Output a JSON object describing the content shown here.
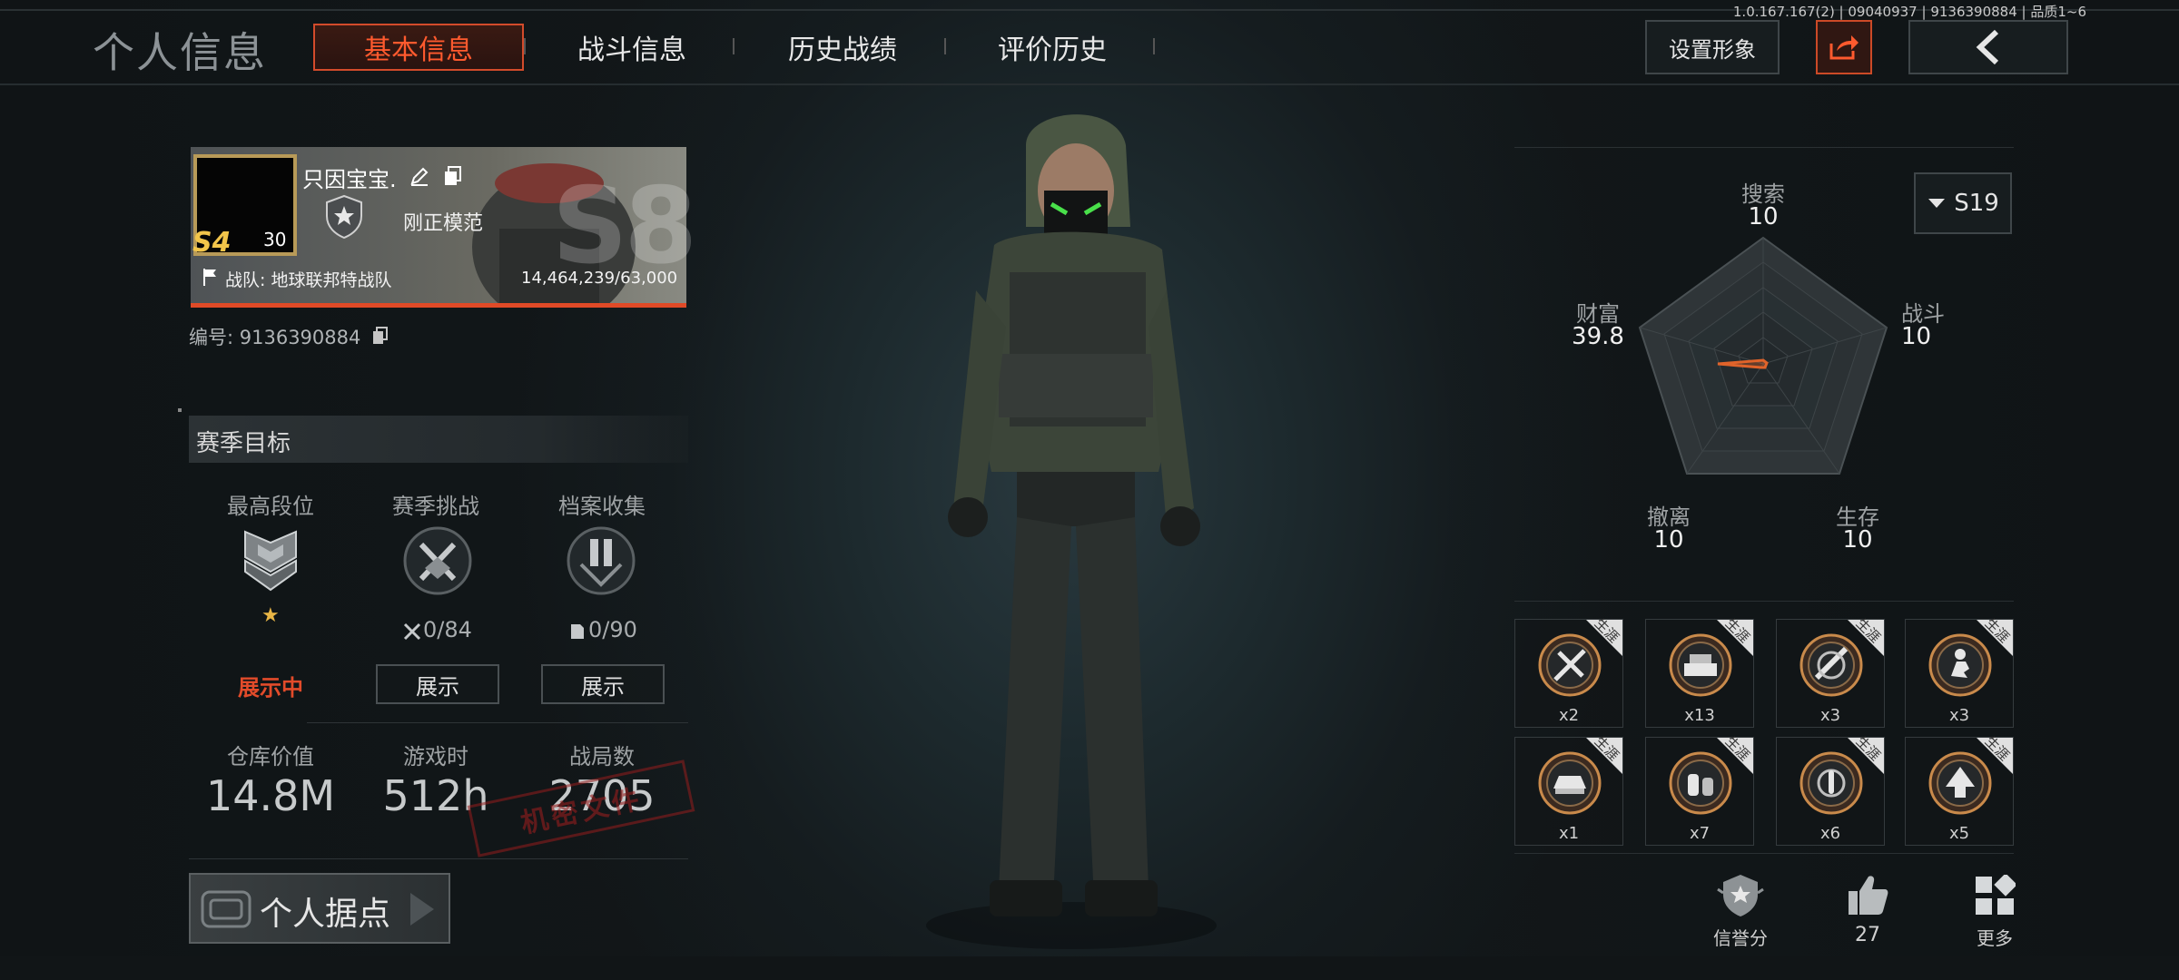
{
  "header": {
    "version": "1.0.167.167(2) | 09040937 | 9136390884 | 品质1~6",
    "title": "个人信息",
    "tabs": [
      {
        "label": "基本信息",
        "active": true
      },
      {
        "label": "战斗信息",
        "active": false
      },
      {
        "label": "历史战绩",
        "active": false
      },
      {
        "label": "评价历史",
        "active": false
      }
    ],
    "set_appearance": "设置形象",
    "share_icon": "share-icon",
    "back_icon": "chevron-left-icon"
  },
  "profile": {
    "name": "只因宝宝.",
    "title": "刚正模范",
    "rank_badge": "S4",
    "level": "30",
    "team": "战队: 地球联邦特战队",
    "exp": "14,464,239/63,000",
    "id_label": "编号: 9136390884",
    "season_stamp": "S8"
  },
  "season_goals": {
    "heading": "赛季目标",
    "items": [
      {
        "label": "最高段位",
        "sub": "★",
        "action": "展示中",
        "action_active": true
      },
      {
        "label": "赛季挑战",
        "sub": "0/84",
        "action": "展示",
        "action_active": false
      },
      {
        "label": "档案收集",
        "sub": "0/90",
        "action": "展示",
        "action_active": false
      }
    ]
  },
  "stats": [
    {
      "label": "仓库价值",
      "value": "14.8M"
    },
    {
      "label": "游戏时",
      "value": "512h"
    },
    {
      "label": "战局数",
      "value": "2705"
    }
  ],
  "stamp_text": "机密文件",
  "personal_base": "个人据点",
  "radar": {
    "season": "S19",
    "axes": [
      {
        "label": "搜索",
        "value": "10"
      },
      {
        "label": "战斗",
        "value": "10"
      },
      {
        "label": "生存",
        "value": "10"
      },
      {
        "label": "撤离",
        "value": "10"
      },
      {
        "label": "财富",
        "value": "39.8"
      }
    ],
    "accent": "#e0632a"
  },
  "achievements": {
    "badge": "生涯",
    "items": [
      {
        "icon": "crossed-rifle-icon",
        "count": "x2"
      },
      {
        "icon": "loot-pile-icon",
        "count": "x13"
      },
      {
        "icon": "shotgun-icon",
        "count": "x3"
      },
      {
        "icon": "crouch-soldier-icon",
        "count": "x3"
      },
      {
        "icon": "vehicle-icon",
        "count": "x1"
      },
      {
        "icon": "supplies-icon",
        "count": "x7"
      },
      {
        "icon": "bullet-target-icon",
        "count": "x6"
      },
      {
        "icon": "arrow-up-icon",
        "count": "x5"
      }
    ]
  },
  "footer": {
    "credit_label": "信誉分",
    "likes": "27",
    "more_label": "更多"
  }
}
